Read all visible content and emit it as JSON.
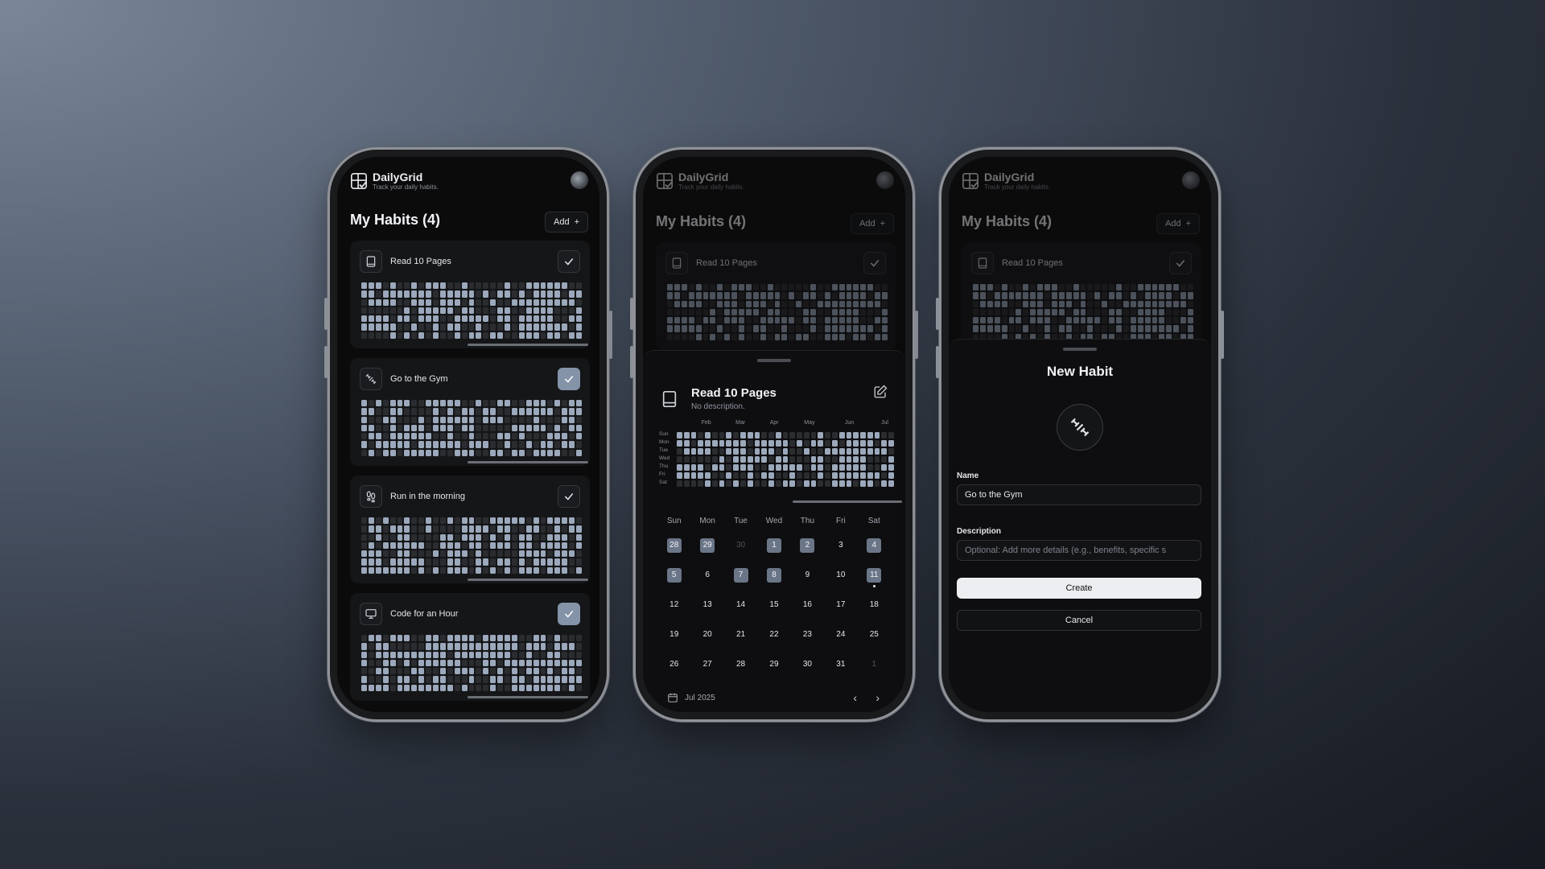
{
  "app": {
    "title": "DailyGrid",
    "tagline": "Track your daily habits."
  },
  "list": {
    "title": "My Habits (4)",
    "add_label": "Add"
  },
  "habits": [
    {
      "name": "Read 10 Pages",
      "icon": "book-icon",
      "done_today": false
    },
    {
      "name": "Go to the Gym",
      "icon": "dumbbell-icon",
      "done_today": true
    },
    {
      "name": "Run in the morning",
      "icon": "footprints-icon",
      "done_today": false
    },
    {
      "name": "Code for an Hour",
      "icon": "monitor-icon",
      "done_today": true
    }
  ],
  "detail": {
    "title": "Read 10 Pages",
    "description": "No description.",
    "months": [
      "Feb",
      "Mar",
      "Apr",
      "May",
      "Jun",
      "Jul"
    ],
    "weekdays_short": [
      "Sun",
      "Mon",
      "Tue",
      "Wed",
      "Thu",
      "Fri",
      "Sat"
    ],
    "calendar": {
      "headers": [
        "Sun",
        "Mon",
        "Tue",
        "Wed",
        "Thu",
        "Fri",
        "Sat"
      ],
      "weeks": [
        [
          "28",
          "29",
          "30",
          "1",
          "2",
          "3",
          "4"
        ],
        [
          "5",
          "6",
          "7",
          "8",
          "9",
          "10",
          "11"
        ],
        [
          "12",
          "13",
          "14",
          "15",
          "16",
          "17",
          "18"
        ],
        [
          "19",
          "20",
          "21",
          "22",
          "23",
          "24",
          "25"
        ],
        [
          "26",
          "27",
          "28",
          "29",
          "30",
          "31",
          "1"
        ]
      ],
      "completed": [
        [
          0,
          0
        ],
        [
          0,
          1
        ],
        [
          0,
          3
        ],
        [
          0,
          4
        ],
        [
          0,
          6
        ],
        [
          1,
          0
        ],
        [
          1,
          2
        ],
        [
          1,
          3
        ],
        [
          1,
          6
        ]
      ],
      "muted": [
        [
          0,
          2
        ],
        [
          4,
          6
        ]
      ],
      "today": [
        1,
        6
      ],
      "month_label": "Jul 2025",
      "prev_icon": "chevron-left-icon",
      "next_icon": "chevron-right-icon"
    }
  },
  "new_habit": {
    "title": "New Habit",
    "icon": "dumbbell-icon",
    "name_label": "Name",
    "name_value": "Go to the Gym",
    "description_label": "Description",
    "description_placeholder": "Optional: Add more details (e.g., benefits, specific s",
    "create_label": "Create",
    "cancel_label": "Cancel"
  },
  "colors": {
    "accent": "#8593a9",
    "cell_on": "#9ca8bb",
    "cell_off": "#2a2c30",
    "background": "#0b0b0c"
  }
}
